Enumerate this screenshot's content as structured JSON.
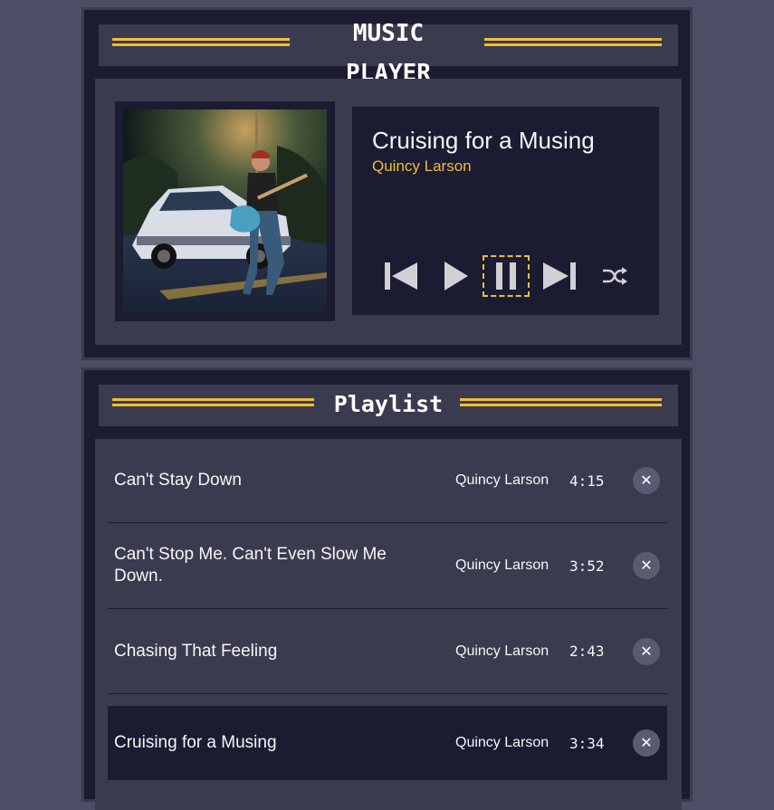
{
  "player": {
    "heading_line1": "MUSIC",
    "heading_line2": "PLAYER",
    "album_art_alt": "song cover art",
    "current_song": {
      "title": "Cruising for a Musing",
      "artist": "Quincy Larson"
    },
    "controls": [
      "previous-icon",
      "play-icon",
      "pause-icon",
      "next-icon",
      "shuffle-icon"
    ]
  },
  "playlist": {
    "heading": "Playlist",
    "songs": [
      {
        "title": "Can't Stay Down",
        "artist": "Quincy Larson",
        "duration": "4:15"
      },
      {
        "title": "Can't Stop Me. Can't Even Slow Me Down.",
        "artist": "Quincy Larson",
        "duration": "3:52"
      },
      {
        "title": "Chasing That Feeling",
        "artist": "Quincy Larson",
        "duration": "2:43"
      },
      {
        "title": "Cruising for a Musing",
        "artist": "Quincy Larson",
        "duration": "3:34"
      }
    ],
    "delete_icon": "close-icon"
  },
  "colors": {
    "background": "#4d4e65",
    "panel_dark": "#1b1b32",
    "panel_mid": "#3b3b4f",
    "accent": "#f1be32",
    "text": "#f5f6f7"
  }
}
